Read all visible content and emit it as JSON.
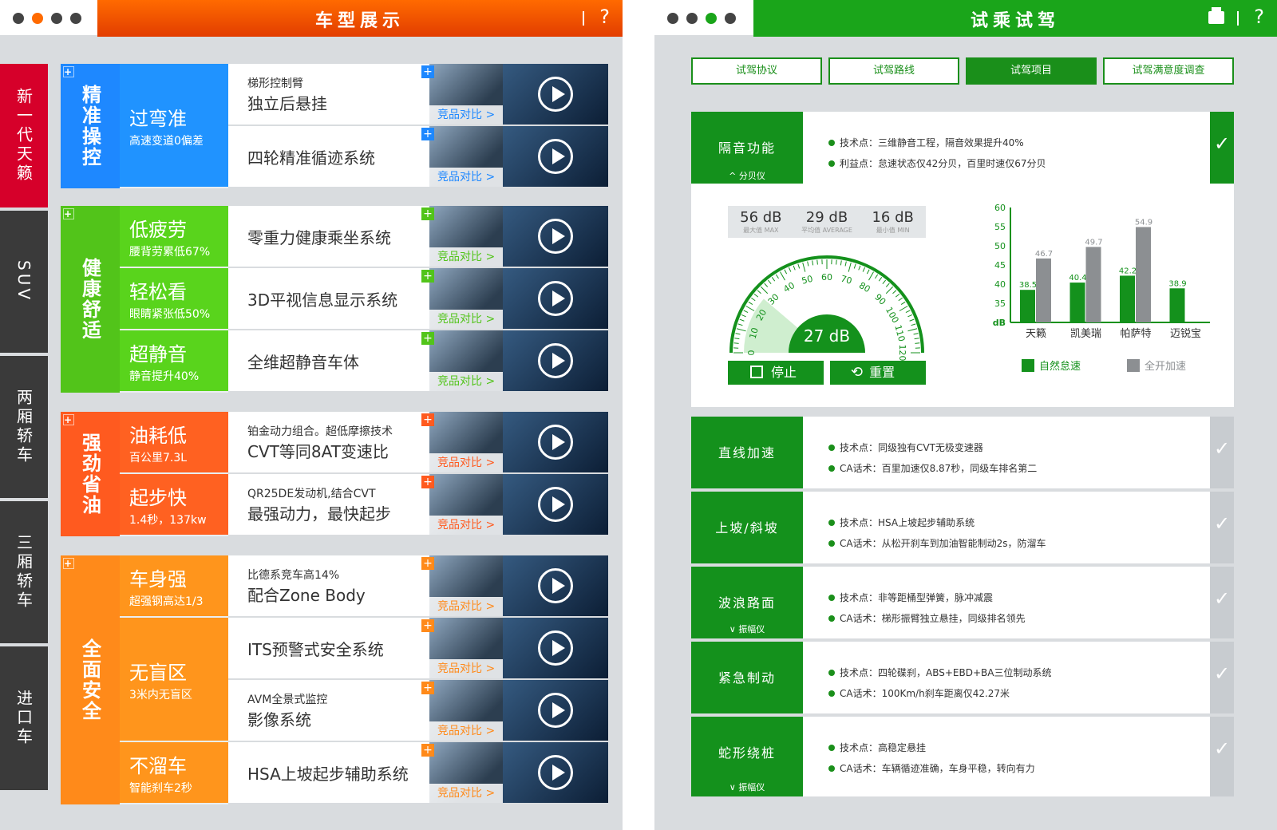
{
  "left": {
    "title": "车型展示",
    "help": "?",
    "nav": [
      {
        "label": "新一代天籁",
        "color": "#d6002a"
      },
      {
        "label": "SUV",
        "color": "#3a3a3a"
      },
      {
        "label": "两厢轿车",
        "color": "#3a3a3a"
      },
      {
        "label": "三厢轿车",
        "color": "#3a3a3a"
      },
      {
        "label": "进口车",
        "color": "#3a3a3a"
      }
    ],
    "compare_label": "竞品对比 >",
    "sections": [
      {
        "category": "精准操控",
        "color": "#1e88ff",
        "features": [
          {
            "big": "过弯准",
            "small": "高速变道0偏差",
            "rows": 2,
            "items": [
              {
                "d1": "梯形控制臂",
                "d2": "独立后悬挂"
              },
              {
                "d1": "",
                "d2": "四轮精准循迹系统"
              }
            ]
          }
        ]
      },
      {
        "category": "健康舒适",
        "color": "#52c41a",
        "features": [
          {
            "big": "低疲劳",
            "small": "腰背劳累低67%",
            "rows": 1,
            "items": [
              {
                "d1": "",
                "d2": "零重力健康乘坐系统"
              }
            ]
          },
          {
            "big": "轻松看",
            "small": "眼睛紧张低50%",
            "rows": 1,
            "items": [
              {
                "d1": "",
                "d2": "3D平视信息显示系统"
              }
            ]
          },
          {
            "big": "超静音",
            "small": "静音提升40%",
            "rows": 1,
            "items": [
              {
                "d1": "",
                "d2": "全维超静音车体"
              }
            ]
          }
        ]
      },
      {
        "category": "强劲省油",
        "color": "#ff5a1f",
        "features": [
          {
            "big": "油耗低",
            "small": "百公里7.3L",
            "rows": 1,
            "items": [
              {
                "d1": "铂金动力组合。超低摩擦技术",
                "d2": "CVT等同8AT变速比"
              }
            ]
          },
          {
            "big": "起步快",
            "small": "1.4秒，137kw",
            "rows": 1,
            "items": [
              {
                "d1": "QR25DE发动机,结合CVT",
                "d2": "最强动力，最快起步"
              }
            ]
          }
        ]
      },
      {
        "category": "全面安全",
        "color": "#ff8a1a",
        "features": [
          {
            "big": "车身强",
            "small": "超强钢高达1/3",
            "rows": 1,
            "items": [
              {
                "d1": "比德系竞车高14%",
                "d2": "配合Zone Body"
              }
            ]
          },
          {
            "big": "无盲区",
            "small": "3米内无盲区",
            "rows": 2,
            "items": [
              {
                "d1": "",
                "d2": "ITS预警式安全系统"
              },
              {
                "d1": "AVM全景式监控",
                "d2": "影像系统"
              }
            ]
          },
          {
            "big": "不溜车",
            "small": "智能刹车2秒",
            "rows": 1,
            "items": [
              {
                "d1": "",
                "d2": "HSA上坡起步辅助系统"
              }
            ]
          }
        ]
      }
    ]
  },
  "right": {
    "title": "试乘试驾",
    "help": "?",
    "tabs": [
      "试驾协议",
      "试驾路线",
      "试驾项目",
      "试驾满意度调查"
    ],
    "active_tab": 2,
    "check": "✓",
    "items": [
      {
        "name": "隔音功能",
        "sub": "^ 分贝仪",
        "p1": "技术点：三维静音工程，隔音效果提升40%",
        "p2": "利益点：怠速状态仅42分贝，百里时速仅67分贝",
        "checked": true
      },
      {
        "name": "直线加速",
        "sub": "",
        "p1": "技术点：同级独有CVT无极变速器",
        "p2": "CA话术：百里加速仅8.87秒，同级车排名第二",
        "checked": false
      },
      {
        "name": "上坡/斜坡",
        "sub": "",
        "p1": "技术点：HSA上坡起步辅助系统",
        "p2": "CA话术：从松开刹车到加油智能制动2s，防溜车",
        "checked": false
      },
      {
        "name": "波浪路面",
        "sub": "∨ 振幅仪",
        "p1": "技术点：非等距桶型弹簧，脉冲减震",
        "p2": "CA话术：梯形振臂独立悬挂，同级排名领先",
        "checked": false
      },
      {
        "name": "紧急制动",
        "sub": "",
        "p1": "技术点：四轮碟刹，ABS+EBD+BA三位制动系统",
        "p2": "CA话术：100Km/h刹车距离仅42.27米",
        "checked": false
      },
      {
        "name": "蛇形绕桩",
        "sub": "∨ 振幅仪",
        "p1": "技术点：高稳定悬挂",
        "p2": "CA话术：车辆循迹准确，车身平稳，转向有力",
        "checked": false
      }
    ],
    "meter": {
      "max": {
        "value": "56 dB",
        "label": "最大值 MAX"
      },
      "avg": {
        "value": "29 dB",
        "label": "平均值 AVERAGE"
      },
      "min": {
        "value": "16 dB",
        "label": "最小值 MIN"
      },
      "current": "27 dB",
      "current_value": 27,
      "gauge_ticks": [
        "0",
        "10",
        "20",
        "30",
        "40",
        "50",
        "60",
        "70",
        "80",
        "90",
        "100",
        "110",
        "120"
      ],
      "stop_label": "停止",
      "reset_label": "重置"
    },
    "chart_data": {
      "type": "bar",
      "categories": [
        "天籁",
        "凯美瑞",
        "帕萨特",
        "迈锐宝"
      ],
      "series": [
        {
          "name": "自然怠速",
          "color": "#14911c",
          "values": [
            38.5,
            40.4,
            42.2,
            38.9
          ]
        },
        {
          "name": "全开加速",
          "color": "#8c8f92",
          "values": [
            46.7,
            49.7,
            54.9,
            null
          ]
        }
      ],
      "ylabel": "dB",
      "ylim": [
        30,
        60
      ],
      "yticks": [
        35,
        40,
        45,
        50,
        55,
        60
      ],
      "legend": "bottom"
    }
  }
}
